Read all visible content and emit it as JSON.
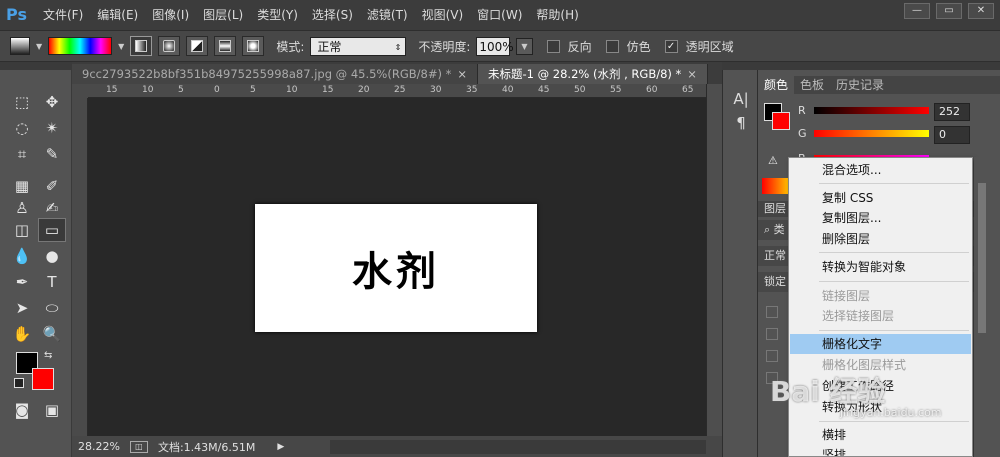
{
  "app": {
    "logo": "Ps"
  },
  "menu": [
    "文件(F)",
    "编辑(E)",
    "图像(I)",
    "图层(L)",
    "类型(Y)",
    "选择(S)",
    "滤镜(T)",
    "视图(V)",
    "窗口(W)",
    "帮助(H)"
  ],
  "window_controls": {
    "minimize": "—",
    "restore": "▭",
    "close": "✕"
  },
  "options": {
    "mode_label": "模式:",
    "mode_value": "正常",
    "opacity_label": "不透明度:",
    "opacity_value": "100%",
    "reverse_label": "反向",
    "dither_label": "仿色",
    "transparency_label": "透明区域",
    "transparency_checked": "✓"
  },
  "tabs": [
    {
      "label": "9cc2793522b8bf351b84975255998a87.jpg @ 45.5%(RGB/8#) *",
      "close": "×"
    },
    {
      "label": "未标题-1 @ 28.2% (水剂 , RGB/8) *",
      "close": "×"
    }
  ],
  "ruler": {
    "ticks": [
      "15",
      "10",
      "5",
      "0",
      "5",
      "10",
      "15",
      "20",
      "25",
      "30",
      "35",
      "40",
      "45",
      "50",
      "55",
      "60",
      "65"
    ]
  },
  "canvas": {
    "text": "水剂"
  },
  "status": {
    "zoom": "28.22%",
    "doc": "文档:1.43M/6.51M",
    "arrow": "▶"
  },
  "color_panel": {
    "tabs": [
      "颜色",
      "色板",
      "历史记录"
    ],
    "r_label": "R",
    "r_value": "252",
    "g_label": "G",
    "g_value": "0",
    "b_label": "B"
  },
  "layers_panel": {
    "title": "图层",
    "kind_prefix": "类",
    "blend": "正常",
    "lock": "锁定"
  },
  "context_menu": {
    "items": [
      {
        "label": "混合选项...",
        "enabled": true
      },
      {
        "label": "复制 CSS",
        "enabled": true
      },
      {
        "label": "复制图层...",
        "enabled": true
      },
      {
        "label": "删除图层",
        "enabled": true
      },
      {
        "label": "转换为智能对象",
        "enabled": true
      },
      {
        "label": "链接图层",
        "enabled": false
      },
      {
        "label": "选择链接图层",
        "enabled": false
      },
      {
        "label": "栅格化文字",
        "enabled": true,
        "highlighted": true
      },
      {
        "label": "栅格化图层样式",
        "enabled": false
      },
      {
        "label": "创建工作路径",
        "enabled": true
      },
      {
        "label": "转换为形状",
        "enabled": true
      },
      {
        "label": "横排",
        "enabled": true
      },
      {
        "label": "竖排",
        "enabled": true
      }
    ]
  },
  "watermark": {
    "text": "Bai 经验",
    "sub": "jingyan.baidu.com"
  },
  "colors": {
    "accent": "#4aa0e6",
    "highlight": "#9fcbf2",
    "red": "#ff0000"
  }
}
